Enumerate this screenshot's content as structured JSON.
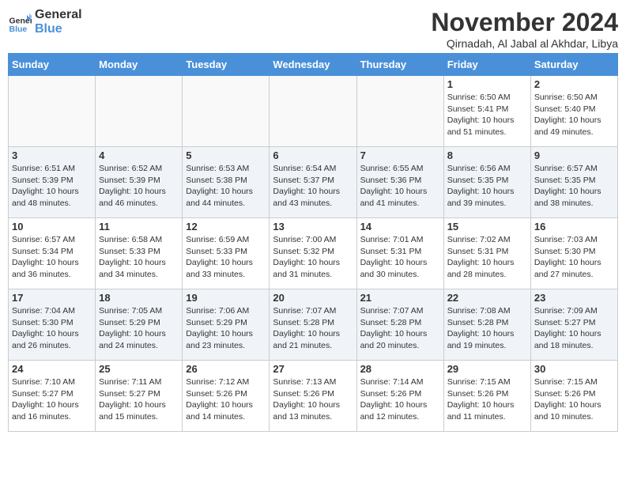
{
  "logo": {
    "line1": "General",
    "line2": "Blue"
  },
  "title": "November 2024",
  "subtitle": "Qirnadah, Al Jabal al Akhdar, Libya",
  "weekdays": [
    "Sunday",
    "Monday",
    "Tuesday",
    "Wednesday",
    "Thursday",
    "Friday",
    "Saturday"
  ],
  "weeks": [
    [
      {
        "day": "",
        "info": ""
      },
      {
        "day": "",
        "info": ""
      },
      {
        "day": "",
        "info": ""
      },
      {
        "day": "",
        "info": ""
      },
      {
        "day": "",
        "info": ""
      },
      {
        "day": "1",
        "info": "Sunrise: 6:50 AM\nSunset: 5:41 PM\nDaylight: 10 hours and 51 minutes."
      },
      {
        "day": "2",
        "info": "Sunrise: 6:50 AM\nSunset: 5:40 PM\nDaylight: 10 hours and 49 minutes."
      }
    ],
    [
      {
        "day": "3",
        "info": "Sunrise: 6:51 AM\nSunset: 5:39 PM\nDaylight: 10 hours and 48 minutes."
      },
      {
        "day": "4",
        "info": "Sunrise: 6:52 AM\nSunset: 5:39 PM\nDaylight: 10 hours and 46 minutes."
      },
      {
        "day": "5",
        "info": "Sunrise: 6:53 AM\nSunset: 5:38 PM\nDaylight: 10 hours and 44 minutes."
      },
      {
        "day": "6",
        "info": "Sunrise: 6:54 AM\nSunset: 5:37 PM\nDaylight: 10 hours and 43 minutes."
      },
      {
        "day": "7",
        "info": "Sunrise: 6:55 AM\nSunset: 5:36 PM\nDaylight: 10 hours and 41 minutes."
      },
      {
        "day": "8",
        "info": "Sunrise: 6:56 AM\nSunset: 5:35 PM\nDaylight: 10 hours and 39 minutes."
      },
      {
        "day": "9",
        "info": "Sunrise: 6:57 AM\nSunset: 5:35 PM\nDaylight: 10 hours and 38 minutes."
      }
    ],
    [
      {
        "day": "10",
        "info": "Sunrise: 6:57 AM\nSunset: 5:34 PM\nDaylight: 10 hours and 36 minutes."
      },
      {
        "day": "11",
        "info": "Sunrise: 6:58 AM\nSunset: 5:33 PM\nDaylight: 10 hours and 34 minutes."
      },
      {
        "day": "12",
        "info": "Sunrise: 6:59 AM\nSunset: 5:33 PM\nDaylight: 10 hours and 33 minutes."
      },
      {
        "day": "13",
        "info": "Sunrise: 7:00 AM\nSunset: 5:32 PM\nDaylight: 10 hours and 31 minutes."
      },
      {
        "day": "14",
        "info": "Sunrise: 7:01 AM\nSunset: 5:31 PM\nDaylight: 10 hours and 30 minutes."
      },
      {
        "day": "15",
        "info": "Sunrise: 7:02 AM\nSunset: 5:31 PM\nDaylight: 10 hours and 28 minutes."
      },
      {
        "day": "16",
        "info": "Sunrise: 7:03 AM\nSunset: 5:30 PM\nDaylight: 10 hours and 27 minutes."
      }
    ],
    [
      {
        "day": "17",
        "info": "Sunrise: 7:04 AM\nSunset: 5:30 PM\nDaylight: 10 hours and 26 minutes."
      },
      {
        "day": "18",
        "info": "Sunrise: 7:05 AM\nSunset: 5:29 PM\nDaylight: 10 hours and 24 minutes."
      },
      {
        "day": "19",
        "info": "Sunrise: 7:06 AM\nSunset: 5:29 PM\nDaylight: 10 hours and 23 minutes."
      },
      {
        "day": "20",
        "info": "Sunrise: 7:07 AM\nSunset: 5:28 PM\nDaylight: 10 hours and 21 minutes."
      },
      {
        "day": "21",
        "info": "Sunrise: 7:07 AM\nSunset: 5:28 PM\nDaylight: 10 hours and 20 minutes."
      },
      {
        "day": "22",
        "info": "Sunrise: 7:08 AM\nSunset: 5:28 PM\nDaylight: 10 hours and 19 minutes."
      },
      {
        "day": "23",
        "info": "Sunrise: 7:09 AM\nSunset: 5:27 PM\nDaylight: 10 hours and 18 minutes."
      }
    ],
    [
      {
        "day": "24",
        "info": "Sunrise: 7:10 AM\nSunset: 5:27 PM\nDaylight: 10 hours and 16 minutes."
      },
      {
        "day": "25",
        "info": "Sunrise: 7:11 AM\nSunset: 5:27 PM\nDaylight: 10 hours and 15 minutes."
      },
      {
        "day": "26",
        "info": "Sunrise: 7:12 AM\nSunset: 5:26 PM\nDaylight: 10 hours and 14 minutes."
      },
      {
        "day": "27",
        "info": "Sunrise: 7:13 AM\nSunset: 5:26 PM\nDaylight: 10 hours and 13 minutes."
      },
      {
        "day": "28",
        "info": "Sunrise: 7:14 AM\nSunset: 5:26 PM\nDaylight: 10 hours and 12 minutes."
      },
      {
        "day": "29",
        "info": "Sunrise: 7:15 AM\nSunset: 5:26 PM\nDaylight: 10 hours and 11 minutes."
      },
      {
        "day": "30",
        "info": "Sunrise: 7:15 AM\nSunset: 5:26 PM\nDaylight: 10 hours and 10 minutes."
      }
    ]
  ]
}
